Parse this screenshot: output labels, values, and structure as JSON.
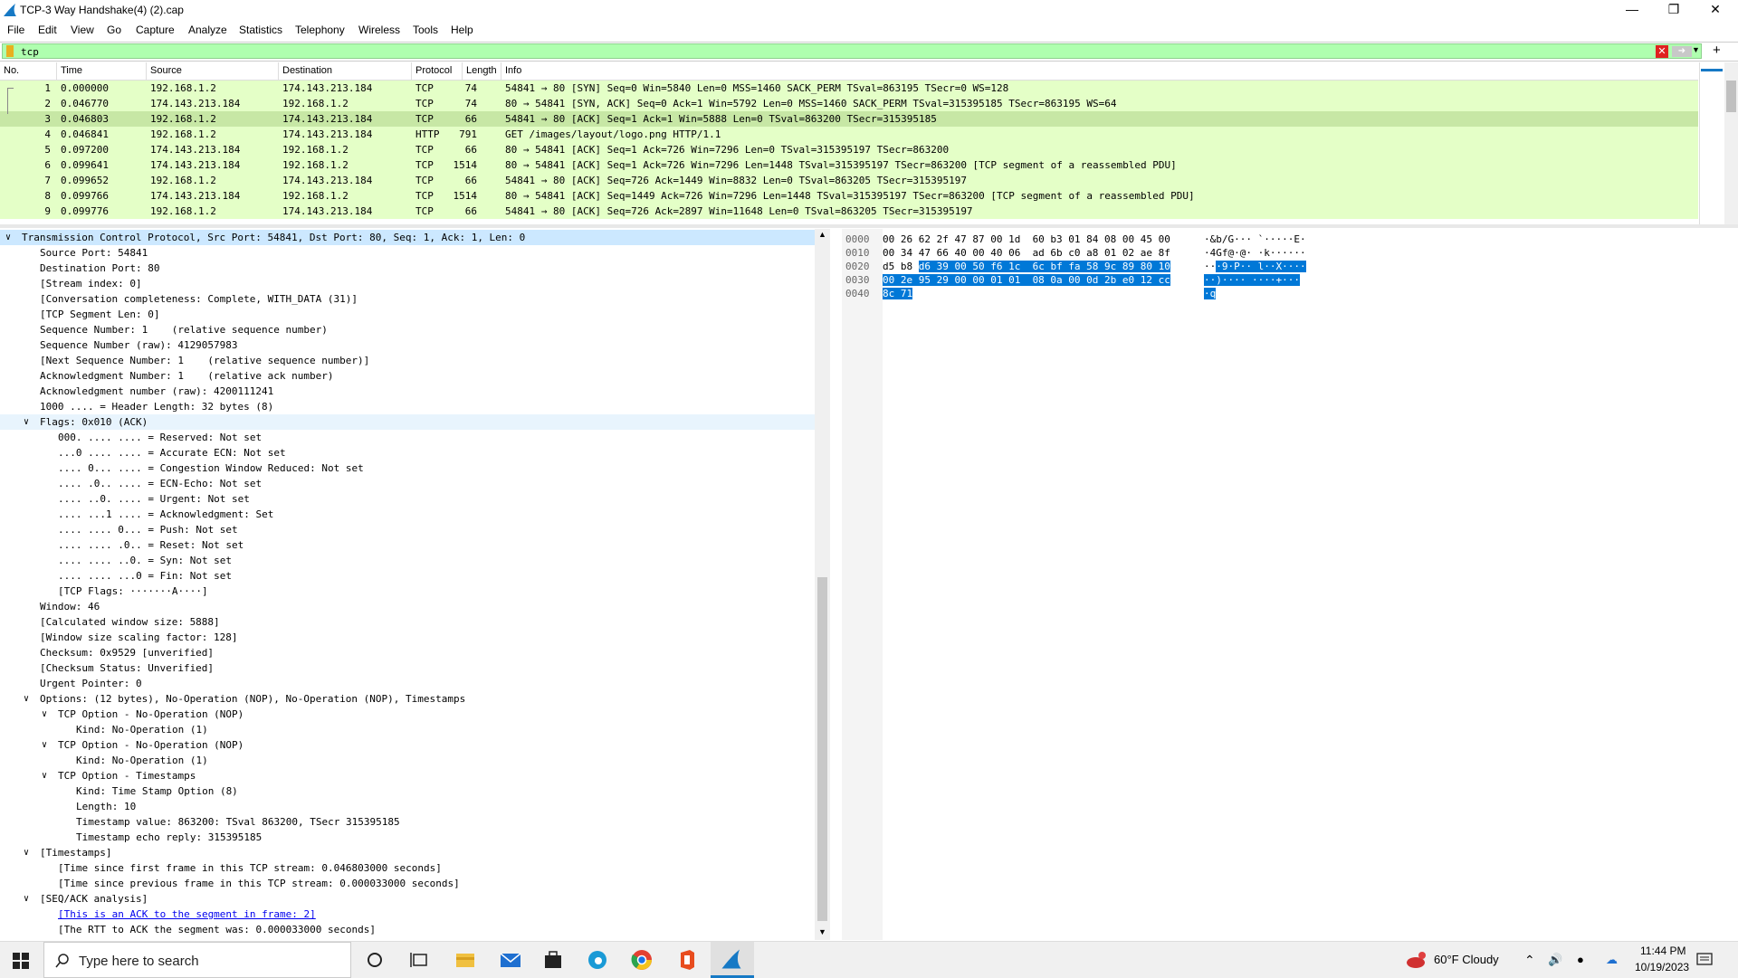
{
  "window": {
    "title": "TCP-3 Way Handshake(4) (2).cap"
  },
  "menu": [
    "File",
    "Edit",
    "View",
    "Go",
    "Capture",
    "Analyze",
    "Statistics",
    "Telephony",
    "Wireless",
    "Tools",
    "Help"
  ],
  "filter": {
    "value": "tcp"
  },
  "packet_list": {
    "columns": [
      "No.",
      "Time",
      "Source",
      "Destination",
      "Protocol",
      "Length",
      "Info"
    ],
    "rows": [
      {
        "no": "1",
        "time": "0.000000",
        "src": "192.168.1.2",
        "dst": "174.143.213.184",
        "proto": "TCP",
        "len": "74",
        "info": "54841 → 80 [SYN] Seq=0 Win=5840 Len=0 MSS=1460 SACK_PERM TSval=863195 TSecr=0 WS=128"
      },
      {
        "no": "2",
        "time": "0.046770",
        "src": "174.143.213.184",
        "dst": "192.168.1.2",
        "proto": "TCP",
        "len": "74",
        "info": "80 → 54841 [SYN, ACK] Seq=0 Ack=1 Win=5792 Len=0 MSS=1460 SACK_PERM TSval=315395185 TSecr=863195 WS=64"
      },
      {
        "no": "3",
        "time": "0.046803",
        "src": "192.168.1.2",
        "dst": "174.143.213.184",
        "proto": "TCP",
        "len": "66",
        "info": "54841 → 80 [ACK] Seq=1 Ack=1 Win=5888 Len=0 TSval=863200 TSecr=315395185"
      },
      {
        "no": "4",
        "time": "0.046841",
        "src": "192.168.1.2",
        "dst": "174.143.213.184",
        "proto": "HTTP",
        "len": "791",
        "info": "GET /images/layout/logo.png HTTP/1.1"
      },
      {
        "no": "5",
        "time": "0.097200",
        "src": "174.143.213.184",
        "dst": "192.168.1.2",
        "proto": "TCP",
        "len": "66",
        "info": "80 → 54841 [ACK] Seq=1 Ack=726 Win=7296 Len=0 TSval=315395197 TSecr=863200"
      },
      {
        "no": "6",
        "time": "0.099641",
        "src": "174.143.213.184",
        "dst": "192.168.1.2",
        "proto": "TCP",
        "len": "1514",
        "info": "80 → 54841 [ACK] Seq=1 Ack=726 Win=7296 Len=1448 TSval=315395197 TSecr=863200 [TCP segment of a reassembled PDU]"
      },
      {
        "no": "7",
        "time": "0.099652",
        "src": "192.168.1.2",
        "dst": "174.143.213.184",
        "proto": "TCP",
        "len": "66",
        "info": "54841 → 80 [ACK] Seq=726 Ack=1449 Win=8832 Len=0 TSval=863205 TSecr=315395197"
      },
      {
        "no": "8",
        "time": "0.099766",
        "src": "174.143.213.184",
        "dst": "192.168.1.2",
        "proto": "TCP",
        "len": "1514",
        "info": "80 → 54841 [ACK] Seq=1449 Ack=726 Win=7296 Len=1448 TSval=315395197 TSecr=863200 [TCP segment of a reassembled PDU]"
      },
      {
        "no": "9",
        "time": "0.099776",
        "src": "192.168.1.2",
        "dst": "174.143.213.184",
        "proto": "TCP",
        "len": "66",
        "info": "54841 → 80 [ACK] Seq=726 Ack=2897 Win=11648 Len=0 TSval=863205 TSecr=315395197"
      }
    ]
  },
  "details": [
    "Transmission Control Protocol, Src Port: 54841, Dst Port: 80, Seq: 1, Ack: 1, Len: 0",
    "Source Port: 54841",
    "Destination Port: 80",
    "[Stream index: 0]",
    "[Conversation completeness: Complete, WITH_DATA (31)]",
    "[TCP Segment Len: 0]",
    "Sequence Number: 1    (relative sequence number)",
    "Sequence Number (raw): 4129057983",
    "[Next Sequence Number: 1    (relative sequence number)]",
    "Acknowledgment Number: 1    (relative ack number)",
    "Acknowledgment number (raw): 4200111241",
    "1000 .... = Header Length: 32 bytes (8)",
    "Flags: 0x010 (ACK)",
    "000. .... .... = Reserved: Not set",
    "...0 .... .... = Accurate ECN: Not set",
    ".... 0... .... = Congestion Window Reduced: Not set",
    ".... .0.. .... = ECN-Echo: Not set",
    ".... ..0. .... = Urgent: Not set",
    ".... ...1 .... = Acknowledgment: Set",
    ".... .... 0... = Push: Not set",
    ".... .... .0.. = Reset: Not set",
    ".... .... ..0. = Syn: Not set",
    ".... .... ...0 = Fin: Not set",
    "[TCP Flags: ·······A····]",
    "Window: 46",
    "[Calculated window size: 5888]",
    "[Window size scaling factor: 128]",
    "Checksum: 0x9529 [unverified]",
    "[Checksum Status: Unverified]",
    "Urgent Pointer: 0",
    "Options: (12 bytes), No-Operation (NOP), No-Operation (NOP), Timestamps",
    "TCP Option - No-Operation (NOP)",
    "Kind: No-Operation (1)",
    "TCP Option - No-Operation (NOP)",
    "Kind: No-Operation (1)",
    "TCP Option - Timestamps",
    "Kind: Time Stamp Option (8)",
    "Length: 10",
    "Timestamp value: 863200: TSval 863200, TSecr 315395185",
    "Timestamp echo reply: 315395185",
    "[Timestamps]",
    "[Time since first frame in this TCP stream: 0.046803000 seconds]",
    "[Time since previous frame in this TCP stream: 0.000033000 seconds]",
    "[SEQ/ACK analysis]",
    "[This is an ACK to the segment in frame: 2]",
    "[The RTT to ACK the segment was: 0.000033000 seconds]"
  ],
  "bytes": {
    "offsets": [
      "0000",
      "0010",
      "0020",
      "0030",
      "0040"
    ],
    "hex_plain": [
      "00 26 62 2f 47 87 00 1d  60 b3 01 84 08 00 45 00",
      "00 34 47 66 40 00 40 06  ad 6b c0 a8 01 02 ae 8f",
      "d5 b8 ",
      "",
      ""
    ],
    "hex_sel": [
      "",
      "",
      "d6 39 00 50 f6 1c  6c bf fa 58 9c 89 80 10",
      "00 2e 95 29 00 00 01 01  08 0a 00 0d 2b e0 12 cc",
      "8c 71"
    ],
    "ascii_plain": [
      "·&b/G··· `·····E·",
      "·4Gf@·@· ·k······",
      "··",
      "",
      ""
    ],
    "ascii_sel": [
      "",
      "",
      "·9·P·· l··X····",
      "··)···· ····+···",
      "·q"
    ]
  },
  "taskbar": {
    "search_placeholder": "Type here to search",
    "weather": "60°F  Cloudy",
    "time": "11:44 PM",
    "date": "10/19/2023"
  }
}
